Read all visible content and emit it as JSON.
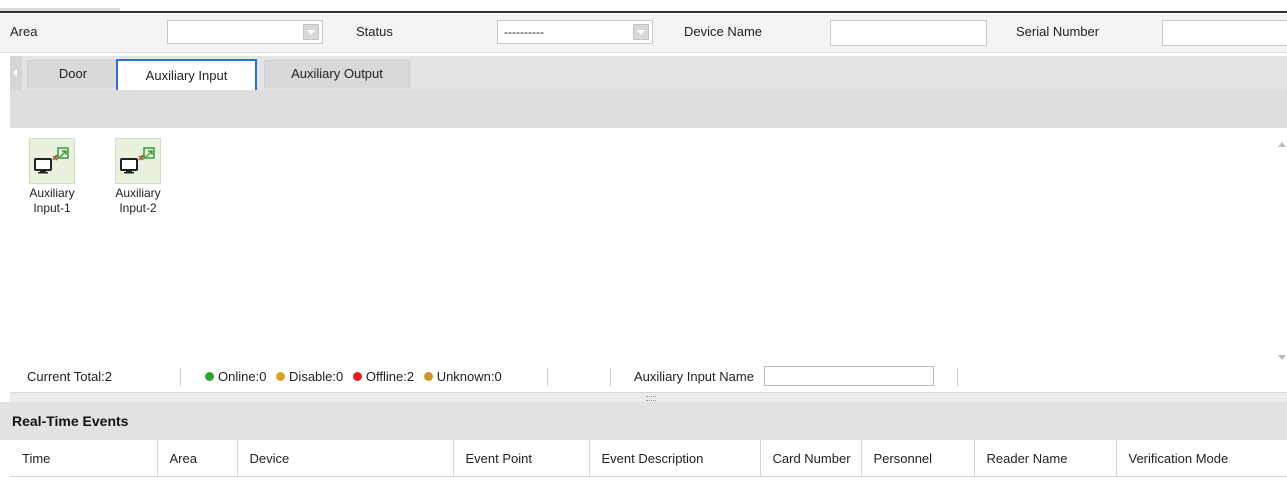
{
  "filters": {
    "area_label": "Area",
    "area_value": "",
    "status_label": "Status",
    "status_value": "----------",
    "device_name_label": "Device Name",
    "device_name_value": "",
    "serial_number_label": "Serial Number",
    "serial_number_value": ""
  },
  "tabs": [
    {
      "label": "Door",
      "active": false
    },
    {
      "label": "Auxiliary Input",
      "active": true
    },
    {
      "label": "Auxiliary Output",
      "active": false
    }
  ],
  "devices": [
    {
      "label": "Auxiliary Input-1",
      "icon": "auxiliary-input-icon"
    },
    {
      "label": "Auxiliary Input-2",
      "icon": "auxiliary-input-icon"
    }
  ],
  "status": {
    "current_total": "Current Total:2",
    "online": "Online:0",
    "disable": "Disable:0",
    "offline": "Offline:2",
    "unknown": "Unknown:0",
    "name_filter_label": "Auxiliary Input Name",
    "name_filter_value": "",
    "colors": {
      "online": "#2fa52f",
      "disable": "#d9a520",
      "offline": "#e02020",
      "unknown": "#c8962a"
    }
  },
  "realtime": {
    "title": "Real-Time Events",
    "columns": [
      "Time",
      "Area",
      "Device",
      "Event Point",
      "Event Description",
      "Card Number",
      "Personnel",
      "Reader Name",
      "Verification Mode"
    ],
    "rows": []
  },
  "colors": {
    "accent": "#2a72c8"
  }
}
